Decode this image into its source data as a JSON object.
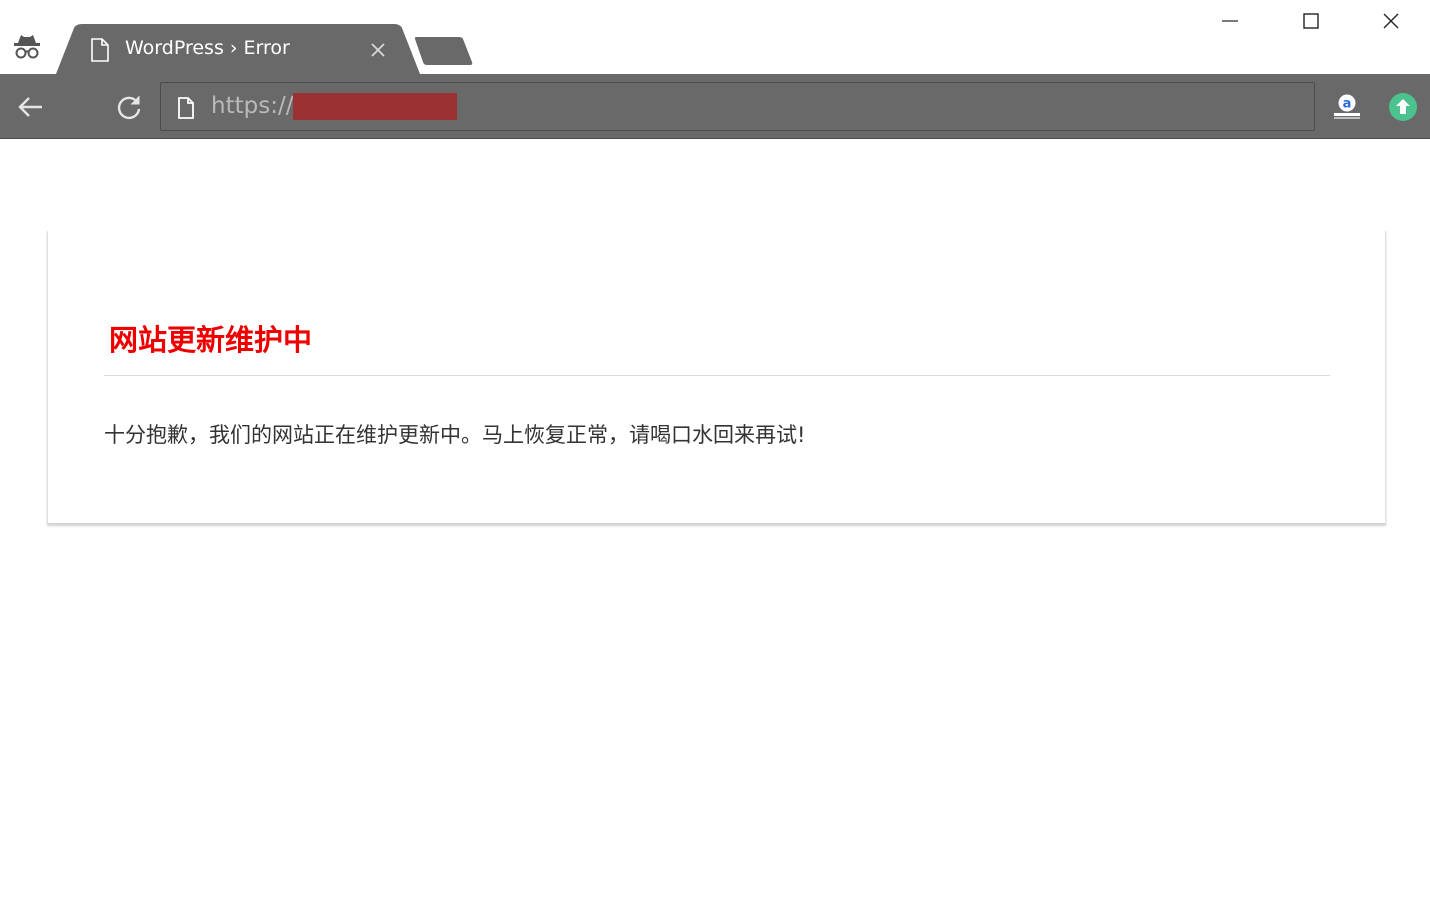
{
  "browser": {
    "tab": {
      "title": "WordPress › Error"
    },
    "address_bar": {
      "url_prefix": "https://",
      "url_redacted": true
    },
    "icons": {
      "incognito": "incognito-icon",
      "tab_page": "page-icon",
      "tab_close": "close-icon",
      "new_tab": "new-tab-icon",
      "back": "back-arrow-icon",
      "reload": "reload-icon",
      "omnibox_page": "page-icon",
      "amazon_extension": "amazon-assistant-icon",
      "upload_extension": "upload-arrow-icon",
      "minimize": "minimize-icon",
      "maximize": "maximize-icon",
      "close_window": "close-icon"
    },
    "colors": {
      "chrome_dark": "#696969",
      "redaction": "#9b3133",
      "extension_green": "#4cc28f"
    }
  },
  "page": {
    "heading": "网站更新维护中",
    "message": "十分抱歉，我们的网站正在维护更新中。马上恢复正常，请喝口水回来再试!",
    "heading_color": "#ee0000"
  }
}
